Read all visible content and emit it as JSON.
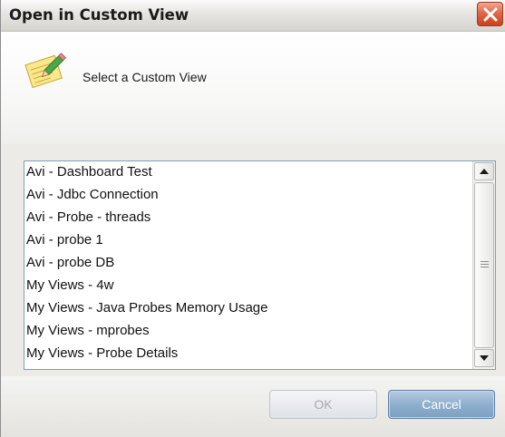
{
  "window": {
    "title": "Open in Custom View",
    "close_icon": "close-icon"
  },
  "header": {
    "prompt": "Select a Custom View",
    "icon": "note-pencil-icon"
  },
  "list": {
    "items": [
      "Avi - Dashboard Test",
      "Avi - Jdbc Connection",
      "Avi - Probe - threads",
      "Avi - probe 1",
      "Avi - probe DB",
      "My Views - 4w",
      "My Views - Java Probes Memory Usage",
      "My Views - mprobes",
      "My Views - Probe Details"
    ]
  },
  "buttons": {
    "ok_label": "OK",
    "cancel_label": "Cancel"
  },
  "colors": {
    "close": "#d9572f",
    "cancel": "#8fafcf",
    "list_border": "#7f9db9"
  }
}
